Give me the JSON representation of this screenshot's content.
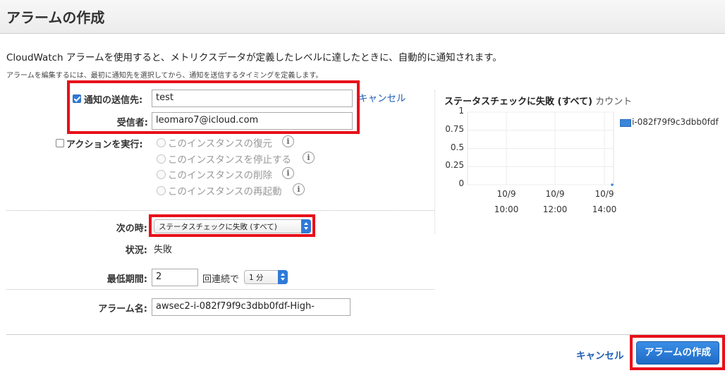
{
  "dialog": {
    "title": "アラームの作成"
  },
  "intro": {
    "description": "CloudWatch アラームを使用すると、メトリクスデータが定義したレベルに達したときに、自動的に通知されます。",
    "sub_description": "アラームを編集するには、最初に通知先を選択してから、通知を送信するタイミングを定義します。"
  },
  "notification": {
    "checkbox_label": "通知の送信先:",
    "checked": true,
    "topic_value": "test",
    "cancel_link": "キャンセル",
    "recipient_label": "受信者:",
    "recipient_value": "leomaro7@icloud.com"
  },
  "actions": {
    "checkbox_label": "アクションを実行:",
    "checked": false,
    "options": [
      {
        "label": "このインスタンスの復元"
      },
      {
        "label": "このインスタンスを停止する"
      },
      {
        "label": "このインスタンスの削除"
      },
      {
        "label": "このインスタンスの再起動"
      }
    ],
    "info_glyph": "i"
  },
  "condition": {
    "when_label": "次の時:",
    "when_value": "ステータスチェックに失敗 (すべて)",
    "state_label": "状況:",
    "state_value": "失敗",
    "period_label": "最低期間:",
    "period_value": "2",
    "consecutive_label": "回連続で",
    "duration_value": "1 分"
  },
  "alarm_name": {
    "label": "アラーム名:",
    "value": "awsec2-i-082f79f9c3dbb0fdf-High-"
  },
  "chart_data": {
    "type": "line",
    "title": "ステータスチェックに失敗 (すべて)",
    "unit": "カウント",
    "y_ticks": [
      "1",
      "0.75",
      "0.5",
      "0.25",
      "0"
    ],
    "ylim": [
      0,
      1
    ],
    "x_ticks": [
      {
        "date": "10/9",
        "time": "10:00"
      },
      {
        "date": "10/9",
        "time": "12:00"
      },
      {
        "date": "10/9",
        "time": "14:00"
      }
    ],
    "series": [
      {
        "name": "i-082f79f9c3dbb0fdf",
        "color": "#3b87d8",
        "values": [
          0
        ]
      }
    ],
    "grid": true,
    "legend_position": "right"
  },
  "footer": {
    "cancel_label": "キャンセル",
    "create_label": "アラームの作成"
  },
  "colors": {
    "accent": "#2f7ad8",
    "highlight": "#e8101a",
    "link": "#1f5fb7"
  }
}
